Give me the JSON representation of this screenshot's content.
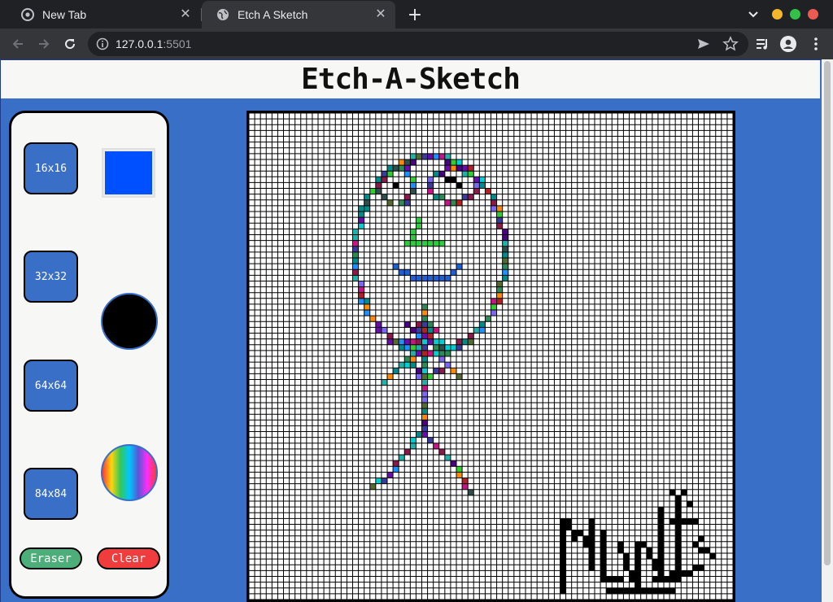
{
  "browser": {
    "tabs": [
      {
        "title": "New Tab",
        "active": false
      },
      {
        "title": "Etch A Sketch",
        "active": true
      }
    ],
    "url_host": "127.0.0.1",
    "url_port": ":5501",
    "window_buttons": {
      "minimize": "#f4b62a",
      "maximize": "#32c048",
      "close": "#ee5a52"
    }
  },
  "page": {
    "title": "Etch-A-Sketch",
    "background": "#3a6fc7",
    "controls": {
      "grid_sizes": [
        "16x16",
        "32x32",
        "64x64",
        "84x84"
      ],
      "current_color": "#0050ff",
      "black_mode": "black",
      "rainbow_mode": "rainbow",
      "eraser_label": "Eraser",
      "clear_label": "Clear"
    },
    "canvas": {
      "grid_size": "84x84",
      "cell_color": "#ffffff",
      "line_color": "#000000"
    }
  }
}
